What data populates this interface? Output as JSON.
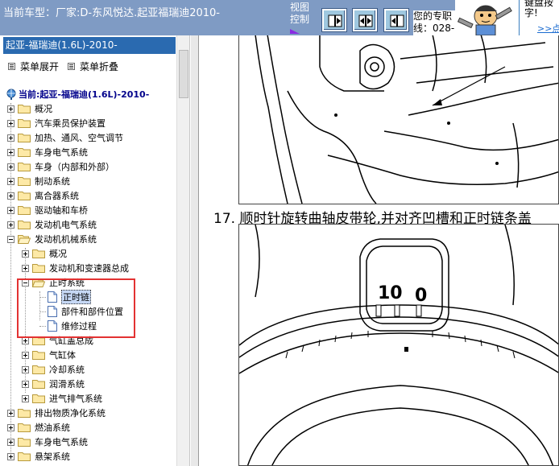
{
  "header": {
    "current_vehicle": "当前车型：厂家:D-东风悦达.起亚福瑞迪2010-",
    "view_control_line1": "视图",
    "view_control_line2": "控制",
    "contact_line1": "您的专职",
    "contact_line2": "线：028-",
    "promo_line1": "键盘按",
    "promo_line2": "字!",
    "promo_link": ">>点"
  },
  "sidebar": {
    "model_title": "起亚-福瑞迪(1.6L)-2010-",
    "expand_label": "菜单展开",
    "collapse_label": "菜单折叠",
    "current_label": "当前:起亚-福瑞迪(1.6L)-2010-",
    "items": [
      {
        "label": "概况"
      },
      {
        "label": "汽车乘员保护装置"
      },
      {
        "label": "加热、通风、空气调节"
      },
      {
        "label": "车身电气系统"
      },
      {
        "label": "车身（内部和外部）"
      },
      {
        "label": "制动系统"
      },
      {
        "label": "离合器系统"
      },
      {
        "label": "驱动轴和车桥"
      },
      {
        "label": "发动机电气系统"
      },
      {
        "label": "发动机机械系统"
      },
      {
        "label": "概况"
      },
      {
        "label": "发动机和变速器总成"
      },
      {
        "label": "正时系统"
      },
      {
        "label": "正时链"
      },
      {
        "label": "部件和部件位置"
      },
      {
        "label": "维修过程"
      },
      {
        "label": "气缸盖总成"
      },
      {
        "label": "气缸体"
      },
      {
        "label": "冷却系统"
      },
      {
        "label": "润滑系统"
      },
      {
        "label": "进气排气系统"
      },
      {
        "label": "排出物质净化系统"
      },
      {
        "label": "燃油系统"
      },
      {
        "label": "车身电气系统"
      },
      {
        "label": "悬架系统"
      }
    ]
  },
  "content": {
    "step_text": "17. 顺时针旋转曲轴皮带轮,并对齐凹槽和正时链条盖",
    "timing_mark_10": "10",
    "timing_mark_0": "0"
  },
  "colors": {
    "header_bg": "#7f9bc4",
    "model_bar_bg": "#2a6ab0",
    "highlight_box": "#e33232",
    "selected_bg": "#c6d8f5"
  },
  "icons": [
    "view-prev-icon",
    "view-both-icon",
    "view-next-icon",
    "mascot-icon",
    "globe-icon",
    "folder-icon",
    "document-icon",
    "expand-icon",
    "collapse-icon"
  ]
}
